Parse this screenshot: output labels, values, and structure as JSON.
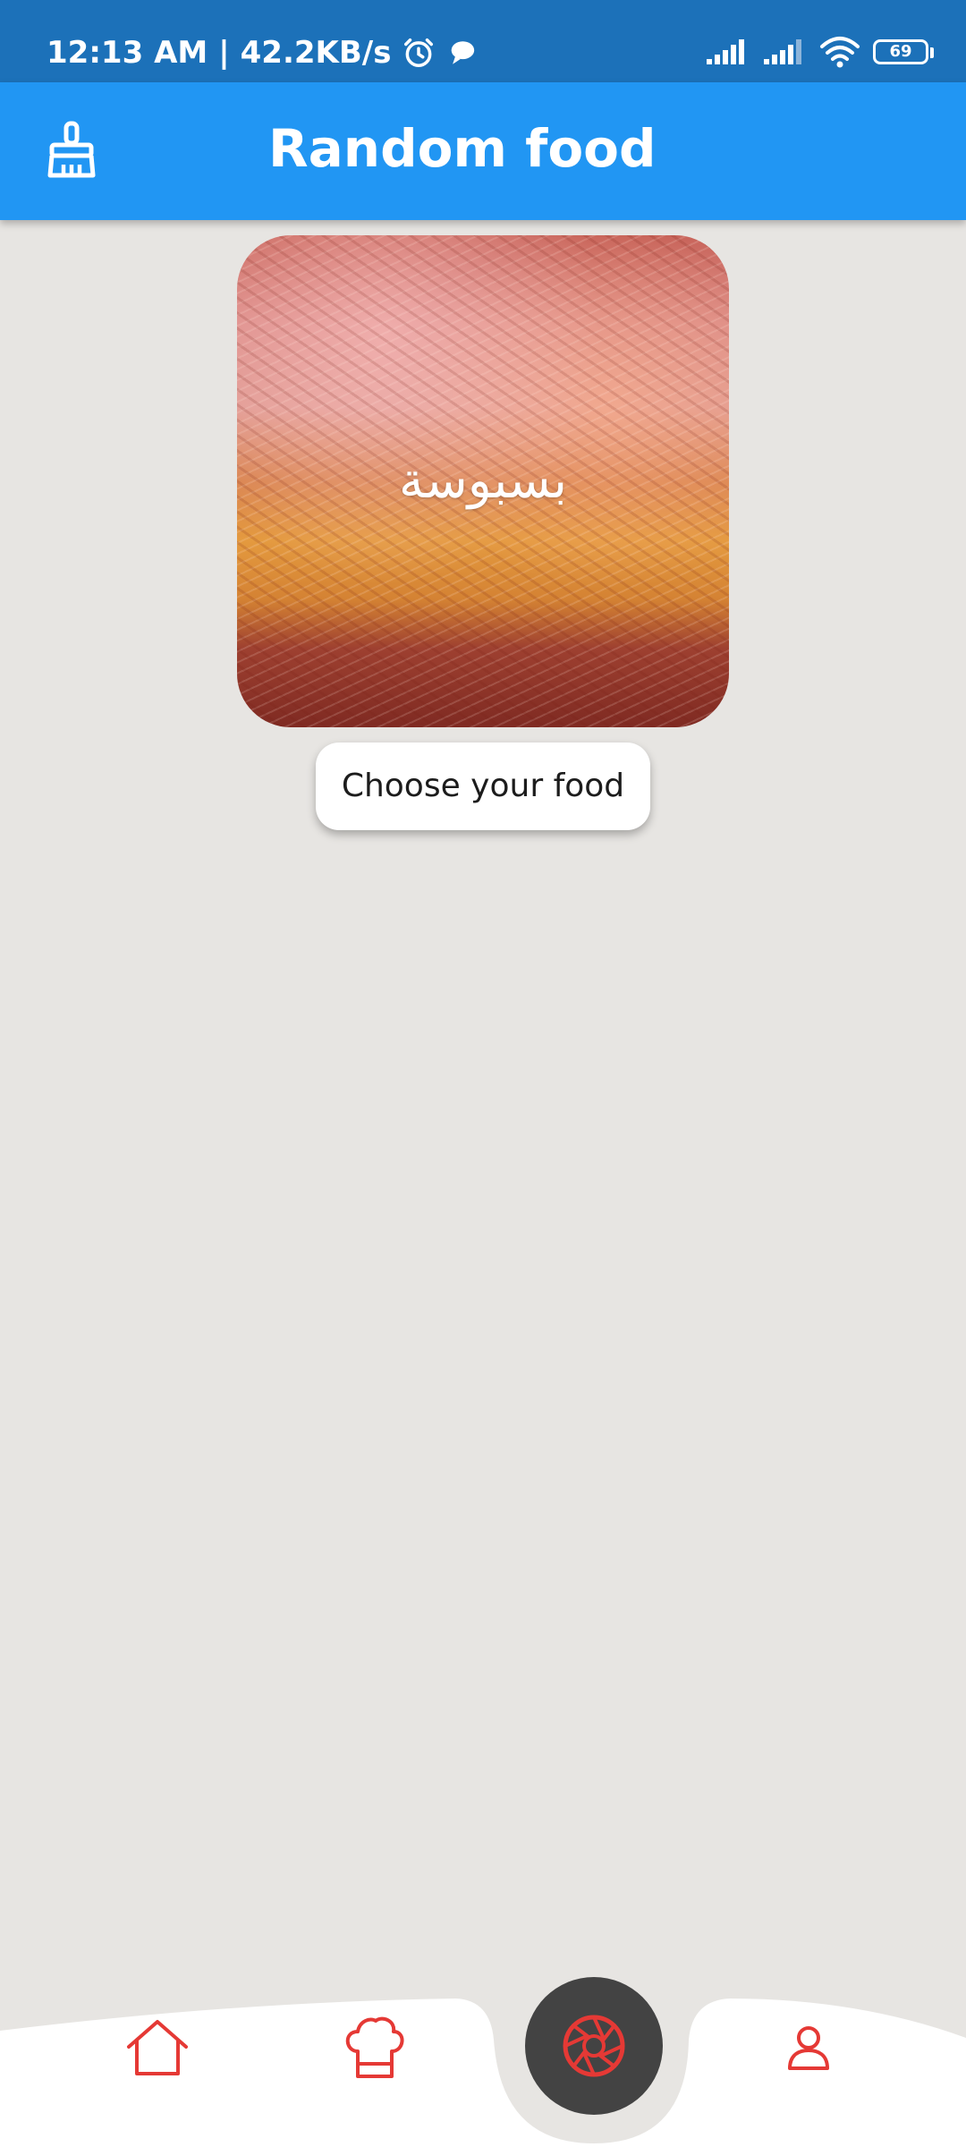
{
  "status_bar": {
    "time": "12:13 AM",
    "separator": "|",
    "speed": "42.2KB/s",
    "battery": "69",
    "icons": [
      "alarm-icon",
      "chat-icon",
      "signal-icon",
      "signal-icon",
      "wifi-icon",
      "battery-icon"
    ]
  },
  "app_bar": {
    "title": "Random food",
    "menu_icon": "brush-icon"
  },
  "food": {
    "name": "بسبوسة"
  },
  "actions": {
    "choose_label": "Choose your food"
  },
  "bottom_nav": {
    "items": [
      {
        "icon": "home-icon"
      },
      {
        "icon": "chef-hat-icon"
      },
      {
        "icon": "shutter-icon"
      },
      {
        "icon": "profile-icon"
      }
    ]
  },
  "colors": {
    "status_bar": "#1c71b9",
    "app_bar": "#2196f3",
    "background": "#e7e5e2",
    "accent": "#e53935",
    "fab": "#434343"
  }
}
